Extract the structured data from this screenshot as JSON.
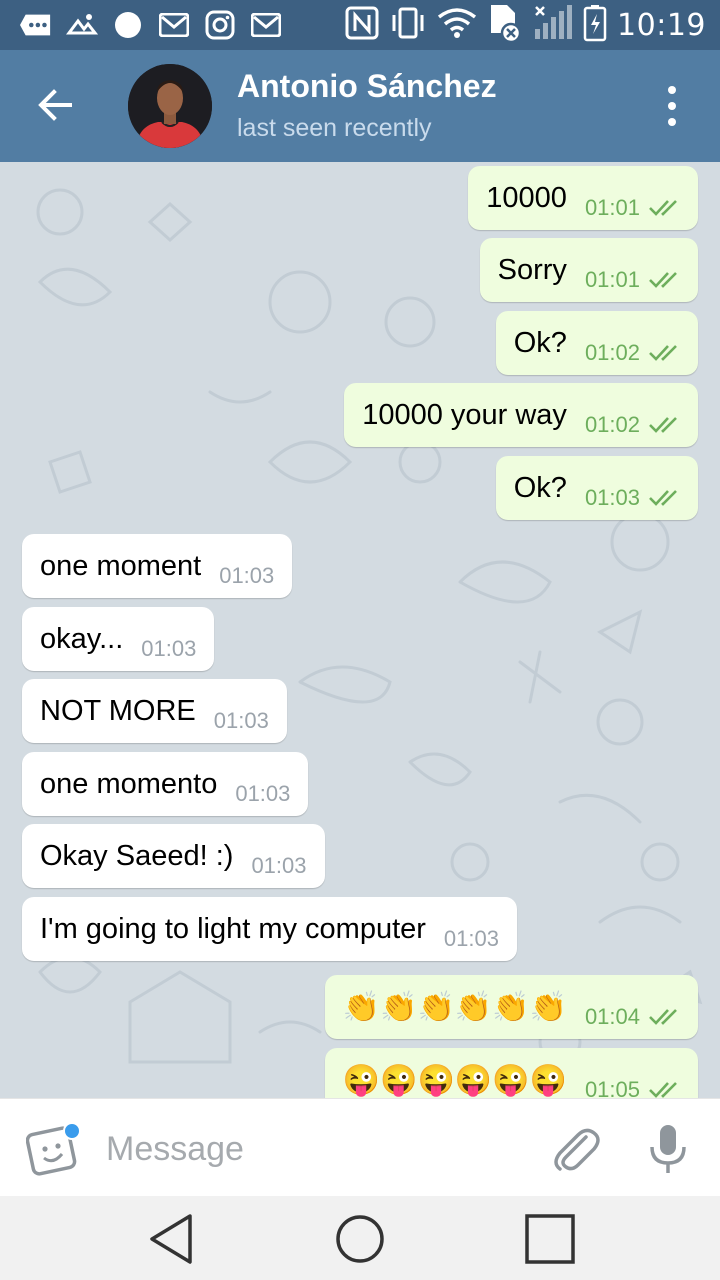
{
  "status_bar": {
    "time": "10:19",
    "icons": [
      "more-icon",
      "photo-icon",
      "circle-icon",
      "gmail-icon",
      "instagram-icon",
      "gmail-icon",
      "nfc-icon",
      "vibrate-icon",
      "wifi-icon",
      "sim-icon",
      "signal-icon",
      "battery-icon"
    ]
  },
  "header": {
    "contact_name": "Antonio Sánchez",
    "status": "last seen recently"
  },
  "messages": [
    {
      "dir": "out",
      "text": "10000",
      "time": "01:01"
    },
    {
      "dir": "out",
      "text": "Sorry",
      "time": "01:01"
    },
    {
      "dir": "out",
      "text": "Ok?",
      "time": "01:02"
    },
    {
      "dir": "out",
      "text": "10000 your way",
      "time": "01:02"
    },
    {
      "dir": "out",
      "text": "Ok?",
      "time": "01:03"
    },
    {
      "dir": "in",
      "text": "one moment",
      "time": "01:03"
    },
    {
      "dir": "in",
      "text": "okay...",
      "time": "01:03"
    },
    {
      "dir": "in",
      "text": "NOT MORE",
      "time": "01:03"
    },
    {
      "dir": "in",
      "text": "one momento",
      "time": "01:03"
    },
    {
      "dir": "in",
      "text": "Okay Saeed! :)",
      "time": "01:03"
    },
    {
      "dir": "in",
      "text": "I'm going to light my computer",
      "time": "01:03"
    },
    {
      "dir": "out",
      "text": "👏👏👏👏👏👏",
      "time": "01:04"
    },
    {
      "dir": "out",
      "text": "😜😜😜😜😜😜",
      "time": "01:05"
    }
  ],
  "input": {
    "placeholder": "Message"
  },
  "colors": {
    "header": "#527da3",
    "status_bar": "#3d6082",
    "outgoing_bubble": "#effdde",
    "incoming_bubble": "#ffffff",
    "chat_background": "#d3dbe1",
    "read_ticks": "#6dae5c"
  }
}
